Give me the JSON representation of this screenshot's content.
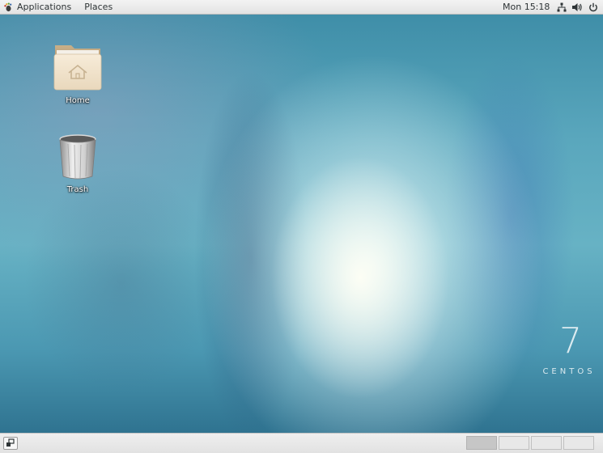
{
  "topbar": {
    "applications_label": "Applications",
    "places_label": "Places",
    "clock": "Mon 15:18",
    "tray_icons": [
      "network-icon",
      "volume-icon",
      "power-icon"
    ]
  },
  "desktop": {
    "icons": [
      {
        "label": "Home",
        "icon": "home-folder-icon"
      },
      {
        "label": "Trash",
        "icon": "trash-icon"
      }
    ],
    "branding": {
      "number": "7",
      "name": "CENTOS"
    }
  },
  "bottombar": {
    "workspace_count": 4,
    "active_workspace": 1
  },
  "colors": {
    "panel": "#e8e8e8",
    "panel_text": "#2e3436",
    "desktop_accent": "#4b98b2"
  }
}
